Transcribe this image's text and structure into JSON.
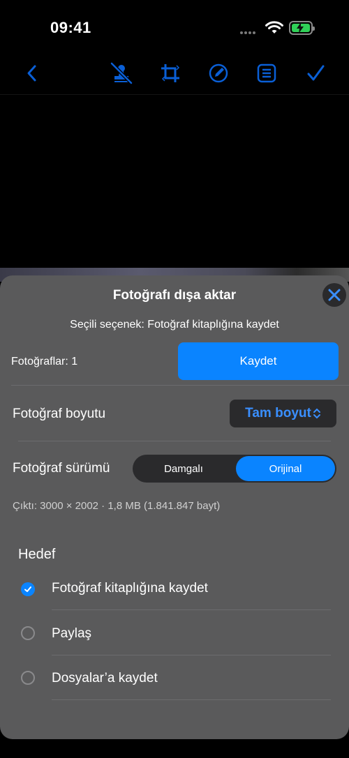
{
  "status": {
    "time": "09:41"
  },
  "toolbar": {
    "icons": [
      "back-icon",
      "no-stamp-icon",
      "crop-icon",
      "edit-icon",
      "list-icon",
      "checkmark-icon"
    ]
  },
  "sheet": {
    "title": "Fotoğrafı dışa aktar",
    "subtitle": "Seçili seçenek: Fotoğraf kitaplığına kaydet",
    "photos_count": "Fotoğraflar: 1",
    "save_label": "Kaydet",
    "size_label": "Fotoğraf boyutu",
    "size_value": "Tam boyut",
    "version_label": "Fotoğraf sürümü",
    "version_options": [
      "Damgalı",
      "Orijinal"
    ],
    "version_selected": "Orijinal",
    "output": "Çıktı: 3000 × 2002 · 1,8 MB (1.841.847 bayt)",
    "target_header": "Hedef",
    "targets": [
      {
        "label": "Fotoğraf kitaplığına kaydet",
        "selected": true
      },
      {
        "label": "Paylaş",
        "selected": false
      },
      {
        "label": "Dosyalar’a kaydet",
        "selected": false
      }
    ]
  },
  "colors": {
    "accent": "#0a84ff",
    "sheet": "#5a5a5b",
    "toolbar_icon": "#0a5fd6",
    "battery": "#30d158"
  }
}
